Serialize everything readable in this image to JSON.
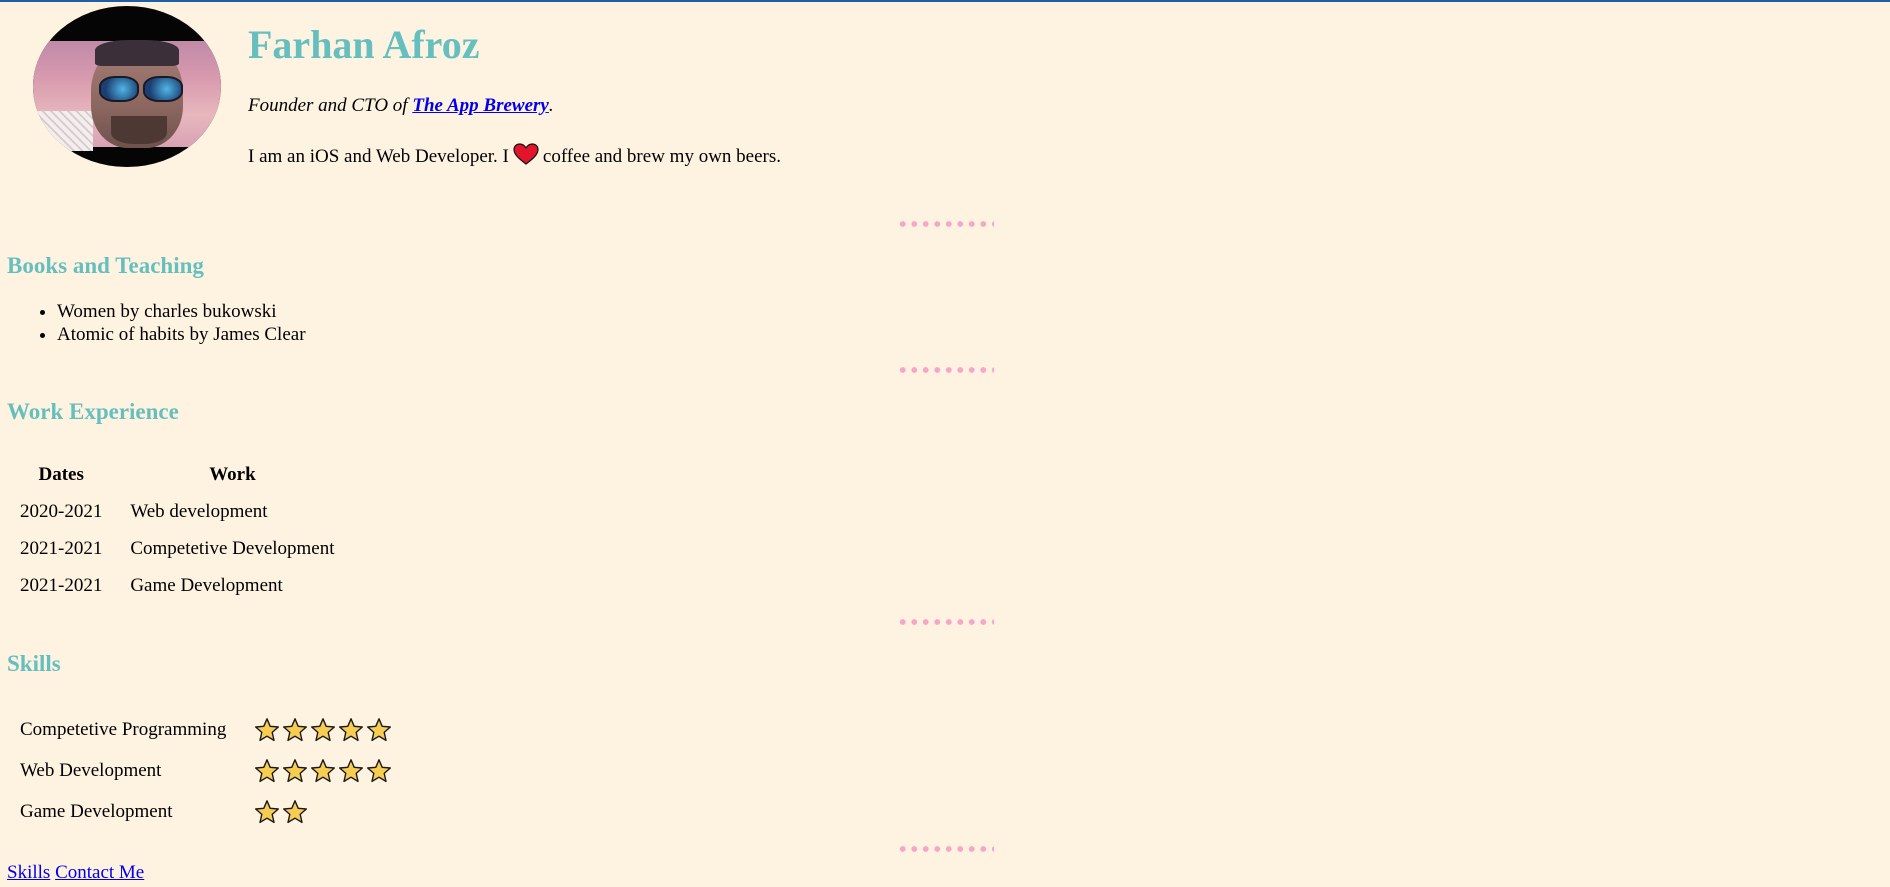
{
  "profile": {
    "name": "Farhan Afroz",
    "tagline_prefix": "Founder and CTO of ",
    "company": "The App Brewery",
    "tagline_suffix": ".",
    "intro_before": "I am an iOS and Web Developer. I",
    "intro_after": "coffee and brew my own beers."
  },
  "books": {
    "heading": "Books and Teaching",
    "items": [
      "Women by charles bukowski",
      "Atomic of habits by James Clear"
    ]
  },
  "work": {
    "heading": "Work Experience",
    "columns": [
      "Dates",
      "Work"
    ],
    "rows": [
      {
        "dates": "2020-2021",
        "work": "Web development"
      },
      {
        "dates": "2021-2021",
        "work": "Competetive Development"
      },
      {
        "dates": "2021-2021",
        "work": "Game Development"
      }
    ]
  },
  "skills": {
    "heading": "Skills",
    "rows": [
      {
        "name": "Competetive Programming",
        "stars": 5
      },
      {
        "name": "Web Development",
        "stars": 5
      },
      {
        "name": "Game Development",
        "stars": 2
      }
    ]
  },
  "footer": {
    "links": [
      "Skills",
      "Contact Me"
    ]
  },
  "colors": {
    "background": "#fef2e1",
    "heading": "#66bfbf",
    "divider_dots": "#f7a5c8",
    "link": "#0000ee",
    "star_fill": "#f7cc52",
    "heart": "#e3142b"
  },
  "icons": {
    "heart": "heart-icon",
    "star": "star-icon",
    "divider": "dotted-divider"
  }
}
